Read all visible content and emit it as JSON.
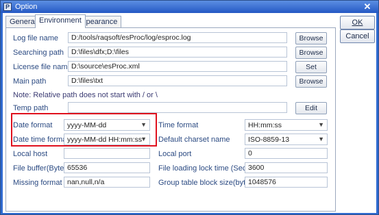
{
  "window": {
    "title": "Option",
    "app_icon_glyph": "P",
    "close_glyph": "✕"
  },
  "tabs": [
    {
      "label": "General"
    },
    {
      "label": "Environment"
    },
    {
      "label": "Appearance"
    }
  ],
  "side_buttons": {
    "ok": "OK",
    "cancel": "Cancel"
  },
  "paths": {
    "log_file_label": "Log file name",
    "log_file_value": "D:/tools/raqsoft/esProc/log/esproc.log",
    "log_file_btn": "Browse",
    "search_path_label": "Searching path",
    "search_path_value": "D:\\files\\dfx;D:\\files",
    "search_path_btn": "Browse",
    "license_label": "License file name",
    "license_value": "D:\\source\\esProc.xml",
    "license_btn": "Set",
    "main_path_label": "Main path",
    "main_path_value": "D:\\files\\txt",
    "main_path_btn": "Browse",
    "note": "Note: Relative path does not start with / or \\",
    "temp_path_label": "Temp path",
    "temp_path_value": "",
    "temp_path_btn": "Edit"
  },
  "settings": {
    "date_format_label": "Date format",
    "date_format_value": "yyyy-MM-dd",
    "date_time_format_label": "Date time format",
    "date_time_format_value": "yyyy-MM-dd HH:mm:ss",
    "time_format_label": "Time format",
    "time_format_value": "HH:mm:ss",
    "charset_label": "Default charset name",
    "charset_value": "ISO-8859-13",
    "local_host_label": "Local host",
    "local_host_value": "",
    "local_port_label": "Local port",
    "local_port_value": "0",
    "file_buffer_label": "File buffer(Byte)",
    "file_buffer_value": "65536",
    "lock_time_label": "File loading lock time (Second)",
    "lock_time_value": "3600",
    "missing_format_label": "Missing format",
    "missing_format_value": "nan,null,n/a",
    "block_size_label": "Group table block size(bytes)",
    "block_size_value": "1048576"
  },
  "icons": {
    "dropdown": "chevron-down-icon"
  },
  "colors": {
    "highlight": "#e0101d",
    "title_bar": "#2f6ad0"
  }
}
